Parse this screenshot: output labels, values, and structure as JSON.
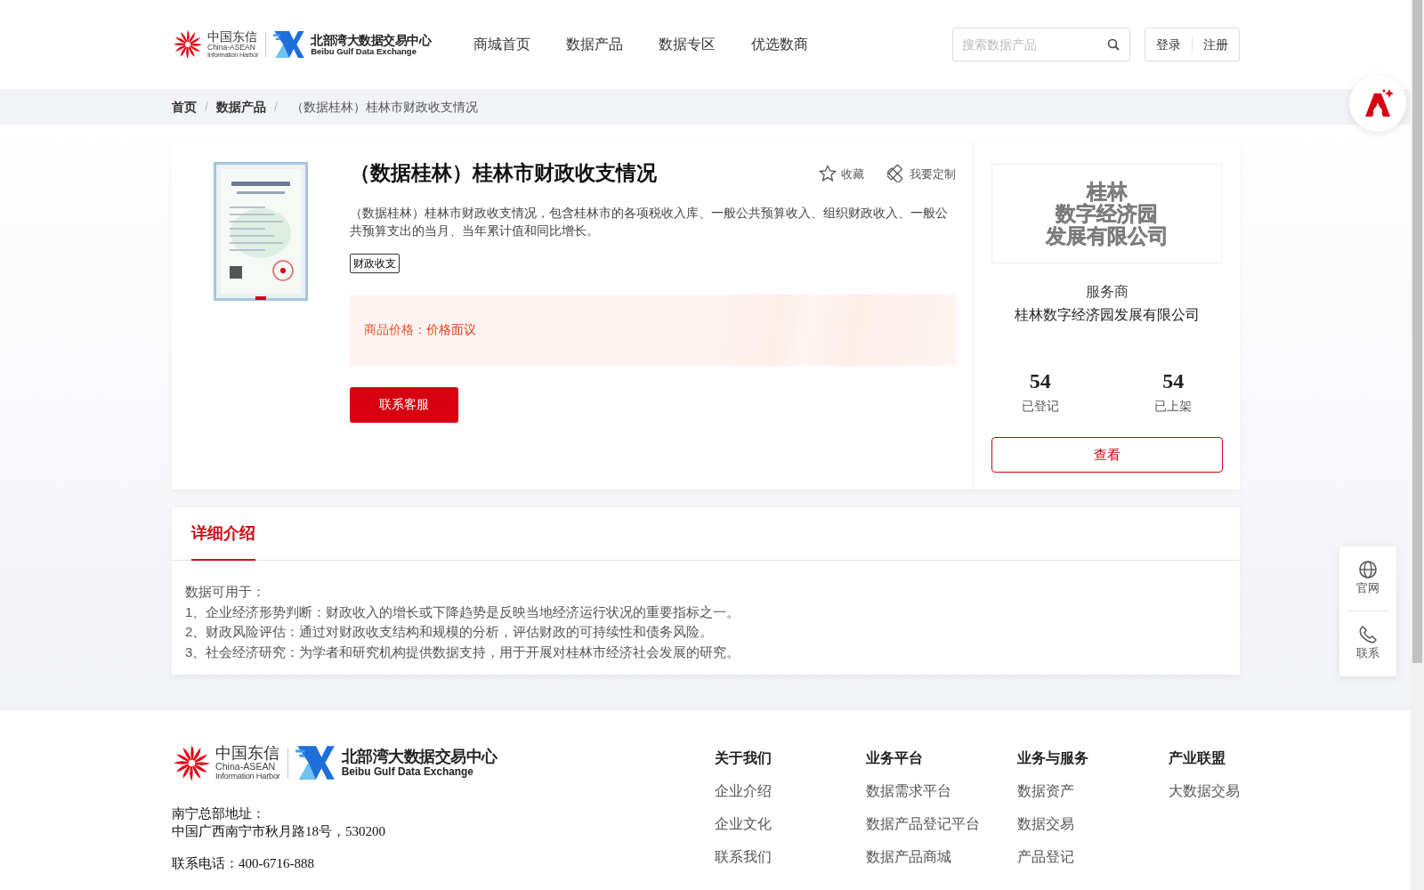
{
  "header": {
    "logo": {
      "telecom_cn": "中国东信",
      "telecom_en1": "China-ASEAN",
      "telecom_en2": "Information Harbor",
      "exchange_cn": "北部湾大数据交易中心",
      "exchange_en": "Beibu Gulf Data Exchange"
    },
    "nav": [
      {
        "label": "商城首页",
        "selected": false
      },
      {
        "label": "数据产品",
        "selected": false
      },
      {
        "label": "数据专区",
        "selected": false
      },
      {
        "label": "优选数商",
        "selected": false
      }
    ],
    "search": {
      "placeholder": "搜索数据产品"
    },
    "auth": [
      "登录",
      "注册"
    ]
  },
  "breadcrumb": [
    {
      "label": "首页",
      "separator": "/"
    },
    {
      "label": "数据产品",
      "separator": "/"
    },
    {
      "label": "（数据桂林）桂林市财政收支情况"
    }
  ],
  "product": {
    "title": "（数据桂林）桂林市财政收支情况",
    "actions": [
      {
        "kind": "star",
        "label": "收藏"
      },
      {
        "kind": "custom",
        "label": "我要定制"
      }
    ],
    "description": "（数据桂林）桂林市财政收支情况，包含桂林市的各项税收入库、一般公共预算收入、组织财政收入、一般公共预算支出的当月、当年累计值和同比增长。",
    "tags": [
      "财政收支"
    ],
    "price_label": "商品价格：",
    "price": "价格面议",
    "button": "联系客服"
  },
  "provider": {
    "logo_lines": [
      "桂林",
      "数字经济园",
      "发展有限公司"
    ],
    "role": "服务商",
    "name": "桂林数字经济园发展有限公司",
    "stats": [
      {
        "value": "54",
        "label": "已登记"
      },
      {
        "value": "54",
        "label": "已上架"
      }
    ],
    "button": "查看"
  },
  "tabs": [
    {
      "label": "详细介绍",
      "selected": true
    }
  ],
  "details": [
    "数据可用于：",
    "1、企业经济形势判断：财政收入的增长或下降趋势是反映当地经济运行状况的重要指标之一。",
    "2、财政风险评估：通过对财政收支结构和规模的分析，评估财政的可持续性和债务风险。",
    "3、社会经济研究：为学者和研究机构提供数据支持，用于开展对桂林市经济社会发展的研究。"
  ],
  "float_tools": [
    {
      "kind": "globe",
      "label": "官网"
    },
    {
      "kind": "phone",
      "label": "联系"
    }
  ],
  "footer": {
    "logo": {
      "telecom_cn": "中国东信",
      "telecom_en1": "China-ASEAN",
      "telecom_en2": "Information Harbor",
      "exchange_cn": "北部湾大数据交易中心",
      "exchange_en": "Beibu Gulf Data Exchange"
    },
    "address_label": "南宁总部地址：",
    "address": "中国广西南宁市秋月路18号，530200",
    "phone": "联系电话：400-6716-888",
    "columns": [
      {
        "title": "关于我们",
        "links": [
          "企业介绍",
          "企业文化",
          "联系我们"
        ]
      },
      {
        "title": "业务平台",
        "links": [
          "数据需求平台",
          "数据产品登记平台",
          "数据产品商城"
        ]
      },
      {
        "title": "业务与服务",
        "links": [
          "数据资产",
          "数据交易",
          "产品登记"
        ]
      },
      {
        "title": "产业联盟",
        "links": [
          "大数据交易"
        ]
      }
    ]
  }
}
